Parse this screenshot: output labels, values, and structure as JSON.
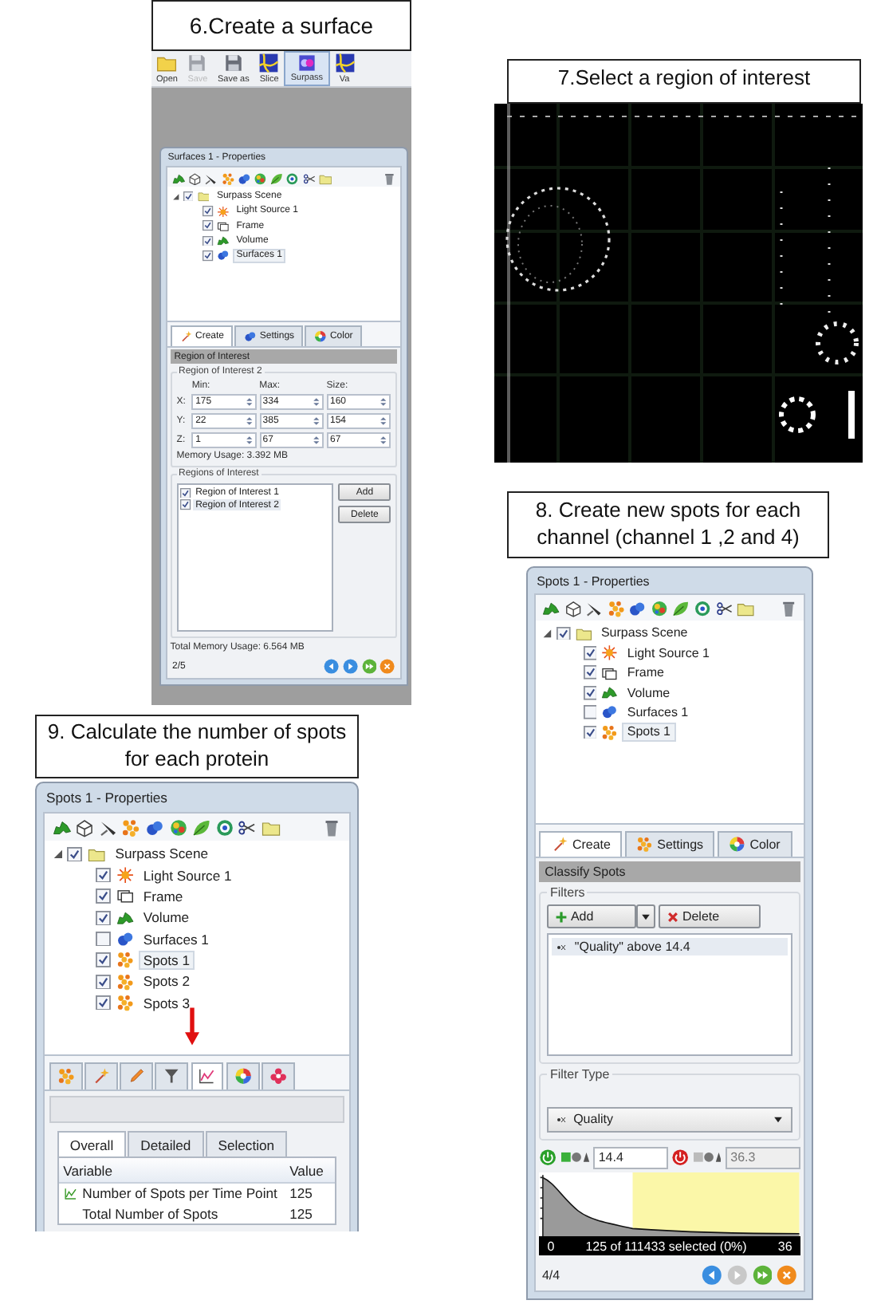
{
  "panels": [
    {
      "kind": "surface",
      "caption": "6.Create a surface",
      "toolbar": [
        {
          "label": "Open",
          "kind": "open",
          "selected": false,
          "disabled": false
        },
        {
          "label": "Save",
          "kind": "save",
          "selected": false,
          "disabled": true
        },
        {
          "label": "Save as",
          "kind": "save",
          "selected": false,
          "disabled": false
        },
        {
          "label": "Slice",
          "kind": "slice",
          "selected": false,
          "disabled": false
        },
        {
          "label": "Surpass",
          "kind": "surpass",
          "selected": true,
          "disabled": false
        },
        {
          "label": "Va",
          "kind": "slice",
          "selected": false,
          "disabled": false
        }
      ],
      "window": {
        "title": "Surfaces 1 - Properties",
        "tree": {
          "label": "Surpass Scene",
          "kind": "scene",
          "checked": true,
          "selected": false,
          "expanded": true,
          "children": [
            {
              "label": "Light Source 1",
              "kind": "light",
              "checked": true,
              "selected": false
            },
            {
              "label": "Frame",
              "kind": "frame",
              "checked": true,
              "selected": false
            },
            {
              "label": "Volume",
              "kind": "volume",
              "checked": true,
              "selected": false
            },
            {
              "label": "Surfaces 1",
              "kind": "surfaces",
              "checked": true,
              "selected": true
            }
          ]
        },
        "tabs": [
          {
            "label": "Create",
            "kind": "wand",
            "selected": true
          },
          {
            "label": "Settings",
            "kind": "surfaces",
            "selected": false
          },
          {
            "label": "Color",
            "kind": "color",
            "selected": false
          }
        ],
        "section": "Region of Interest",
        "roi_group": {
          "title": "Region of Interest 2",
          "columns": [
            "Min:",
            "Max:",
            "Size:"
          ],
          "rows": [
            {
              "axis": "X:",
              "values": [
                "175",
                "334",
                "160"
              ]
            },
            {
              "axis": "Y:",
              "values": [
                "22",
                "385",
                "154"
              ]
            },
            {
              "axis": "Z:",
              "values": [
                "1",
                "67",
                "67"
              ]
            }
          ],
          "memory": "Memory Usage: 3.392 MB"
        },
        "list_group": {
          "title": "Regions of Interest",
          "items": [
            {
              "label": "Region of Interest 1",
              "checked": true,
              "selected": false
            },
            {
              "label": "Region of Interest 2",
              "checked": true,
              "selected": true
            }
          ],
          "buttons": [
            "Add",
            "Delete"
          ]
        },
        "total": "Total Memory Usage: 6.564 MB",
        "page": "2/5",
        "nav": [
          {
            "kind": "back",
            "disabled": false
          },
          {
            "kind": "forward",
            "disabled": false
          },
          {
            "kind": "next",
            "disabled": false
          },
          {
            "kind": "close",
            "disabled": false
          }
        ]
      }
    },
    {
      "caption": "7.Select a region of interest"
    },
    {
      "kind": "spots",
      "caption": "8. Create new spots for each channel (channel 1 ,2 and 4)",
      "window": {
        "title": "Spots 1 - Properties",
        "tree": {
          "label": "Surpass Scene",
          "kind": "scene",
          "checked": true,
          "selected": false,
          "expanded": true,
          "children": [
            {
              "label": "Light Source 1",
              "kind": "light",
              "checked": true,
              "selected": false
            },
            {
              "label": "Frame",
              "kind": "frame",
              "checked": true,
              "selected": false
            },
            {
              "label": "Volume",
              "kind": "volume",
              "checked": true,
              "selected": false
            },
            {
              "label": "Surfaces 1",
              "kind": "surfaces",
              "checked": false,
              "selected": false
            },
            {
              "label": "Spots 1",
              "kind": "spots",
              "checked": true,
              "selected": true
            }
          ]
        },
        "tabs": [
          {
            "label": "Create",
            "kind": "wand",
            "selected": true
          },
          {
            "label": "Settings",
            "kind": "spots",
            "selected": false
          },
          {
            "label": "Color",
            "kind": "color",
            "selected": false
          }
        ],
        "section": "Classify Spots",
        "filters": {
          "title": "Filters",
          "add": "Add",
          "delete": "Delete",
          "items": [
            {
              "label": "\"Quality\" above 14.4",
              "selected": true
            }
          ]
        },
        "filter_type": {
          "title": "Filter Type",
          "value": "Quality"
        },
        "thresholds": [
          {
            "on": true,
            "value": "14.4"
          },
          {
            "on": false,
            "value": "36.3"
          }
        ],
        "status": [
          "0",
          "125 of 111433 selected (0%)",
          "36"
        ],
        "page": "4/4",
        "nav": [
          {
            "kind": "back",
            "disabled": false
          },
          {
            "kind": "forward",
            "disabled": true
          },
          {
            "kind": "next",
            "disabled": false
          },
          {
            "kind": "close",
            "disabled": false
          }
        ]
      }
    },
    {
      "kind": "stats",
      "caption": "9. Calculate the number of spots for each protein",
      "window": {
        "title": "Spots 1 - Properties",
        "tree": {
          "label": "Surpass Scene",
          "kind": "scene",
          "checked": true,
          "selected": false,
          "expanded": true,
          "children": [
            {
              "label": "Light Source 1",
              "kind": "light",
              "checked": true,
              "selected": false
            },
            {
              "label": "Frame",
              "kind": "frame",
              "checked": true,
              "selected": false
            },
            {
              "label": "Volume",
              "kind": "volume",
              "checked": true,
              "selected": false
            },
            {
              "label": "Surfaces 1",
              "kind": "surfaces",
              "checked": false,
              "selected": false
            },
            {
              "label": "Spots 1",
              "kind": "spots",
              "checked": true,
              "selected": true
            },
            {
              "label": "Spots 2",
              "kind": "spots",
              "checked": true,
              "selected": false
            },
            {
              "label": "Spots 3",
              "kind": "spots",
              "checked": true,
              "selected": false
            }
          ]
        },
        "tabs": [
          {
            "kind": "spots",
            "selected": false
          },
          {
            "kind": "wand",
            "selected": false
          },
          {
            "kind": "pencil",
            "selected": false
          },
          {
            "kind": "filter",
            "selected": false
          },
          {
            "kind": "stats",
            "selected": true
          },
          {
            "kind": "color",
            "selected": false
          },
          {
            "kind": "flower",
            "selected": false
          }
        ],
        "subtabs": [
          {
            "label": "Overall",
            "selected": true
          },
          {
            "label": "Detailed",
            "selected": false
          },
          {
            "label": "Selection",
            "selected": false
          }
        ],
        "table": {
          "columns": [
            "Variable",
            "Value"
          ],
          "rows": [
            {
              "variable": "Number of Spots per Time Point",
              "value": "125",
              "kind": "chart"
            },
            {
              "variable": "Total Number of Spots",
              "value": "125",
              "kind": "plain"
            }
          ]
        }
      }
    }
  ]
}
